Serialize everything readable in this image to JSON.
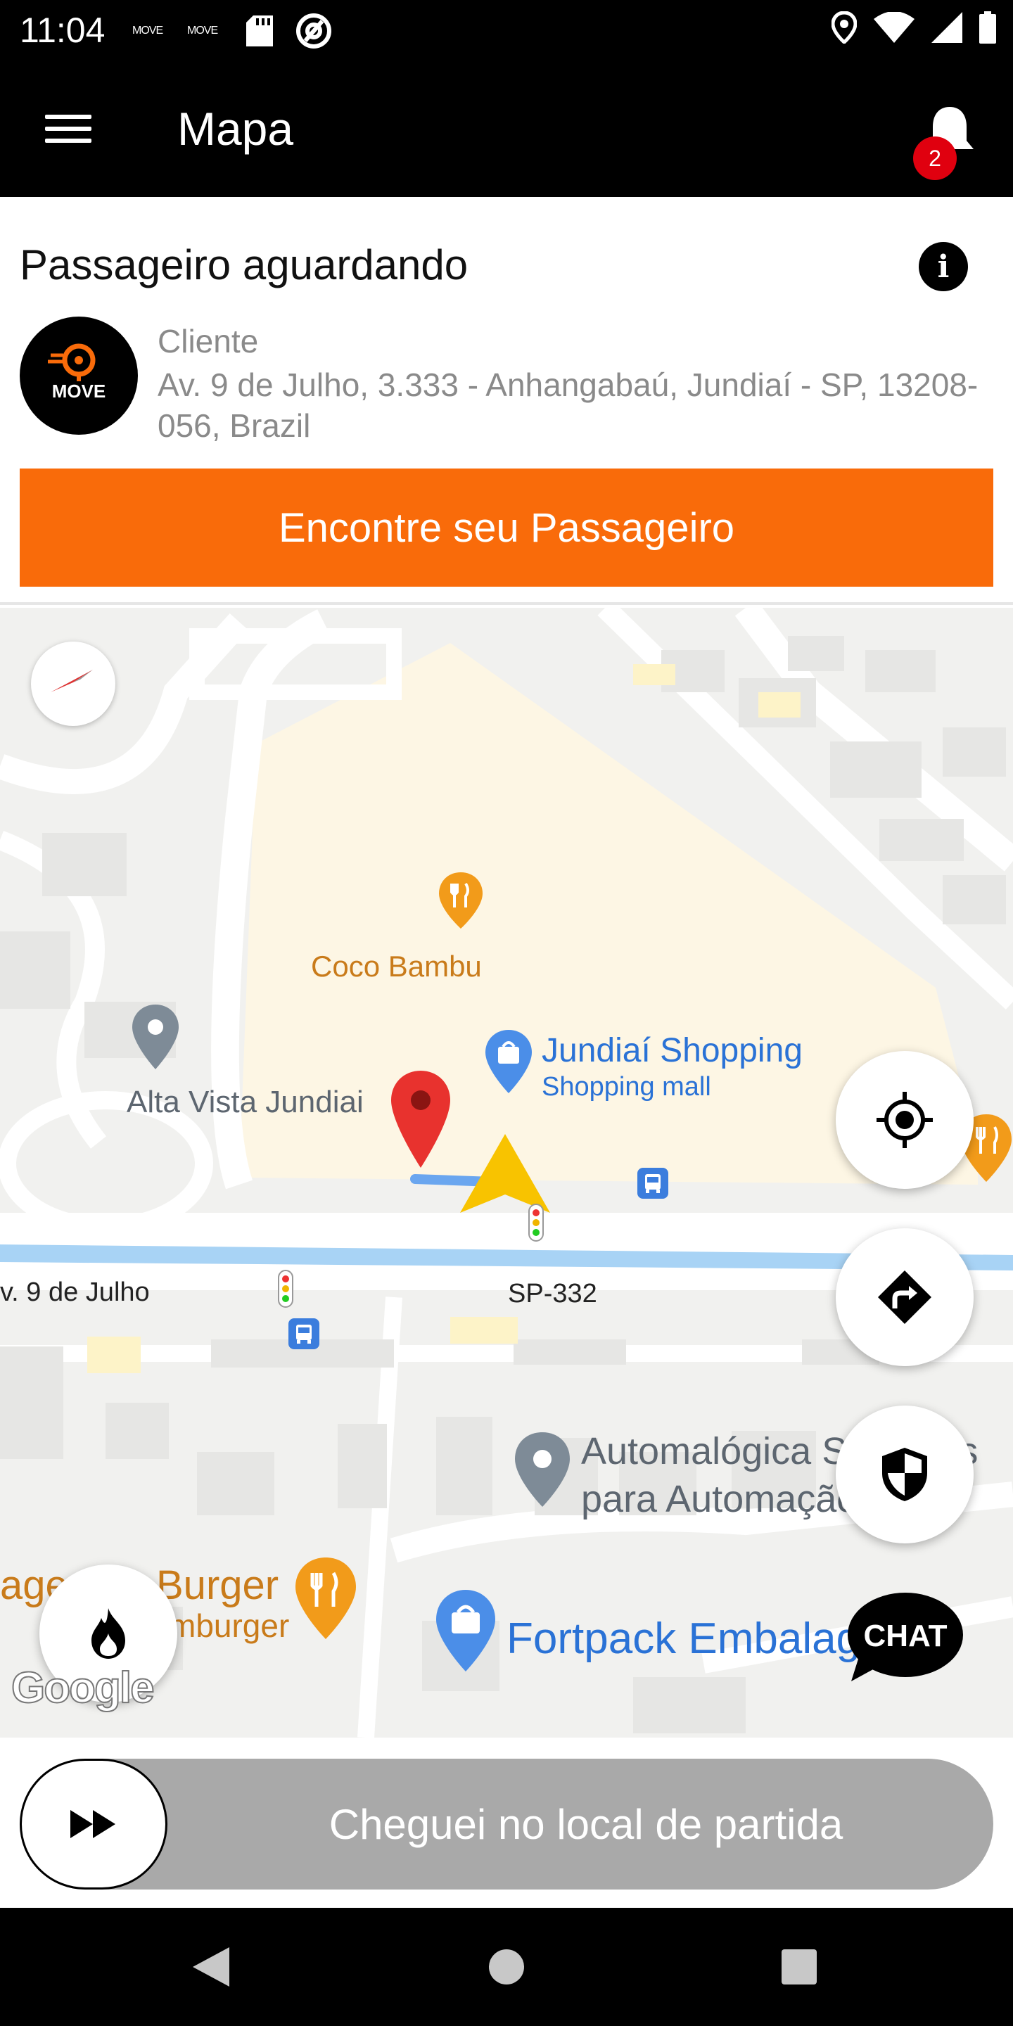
{
  "status_bar": {
    "time": "11:04",
    "notif_1": "MOVE",
    "notif_2": "MOVE"
  },
  "app_bar": {
    "title": "Mapa",
    "notification_count": "2"
  },
  "passenger_card": {
    "title": "Passageiro aguardando",
    "info_label": "i",
    "avatar_logo_text": "MOVE",
    "client_label": "Cliente",
    "address": "Av. 9 de Julho, 3.333 - Anhangabaú, Jundiaí - SP, 13208-056, Brazil",
    "find_button": "Encontre seu Passageiro"
  },
  "map": {
    "places": {
      "coco_bambu": "Coco Bambu",
      "alta_vista": "Alta Vista Jundiai",
      "jundiai_shopping": "Jundiaí Shopping",
      "shopping_mall": "Shopping mall",
      "automalogica_1": "Automalógica Soluções",
      "automalogica_2": "para Automação",
      "burger_1": "Burger",
      "burger_2": "mburger",
      "burger_prefix": "age",
      "fortpack": "Fortpack Embalagens"
    },
    "roads": {
      "av_9_julho": "v. 9 de Julho",
      "sp_332": "SP-332"
    },
    "google_logo": "Google",
    "chat_label": "CHAT"
  },
  "slider": {
    "label": "Cheguei no local de partida"
  },
  "colors": {
    "accent_orange": "#f96b0a",
    "badge_red": "#e0000f",
    "slider_gray": "#a9a9a9",
    "route_blue": "#a8d3f5"
  }
}
